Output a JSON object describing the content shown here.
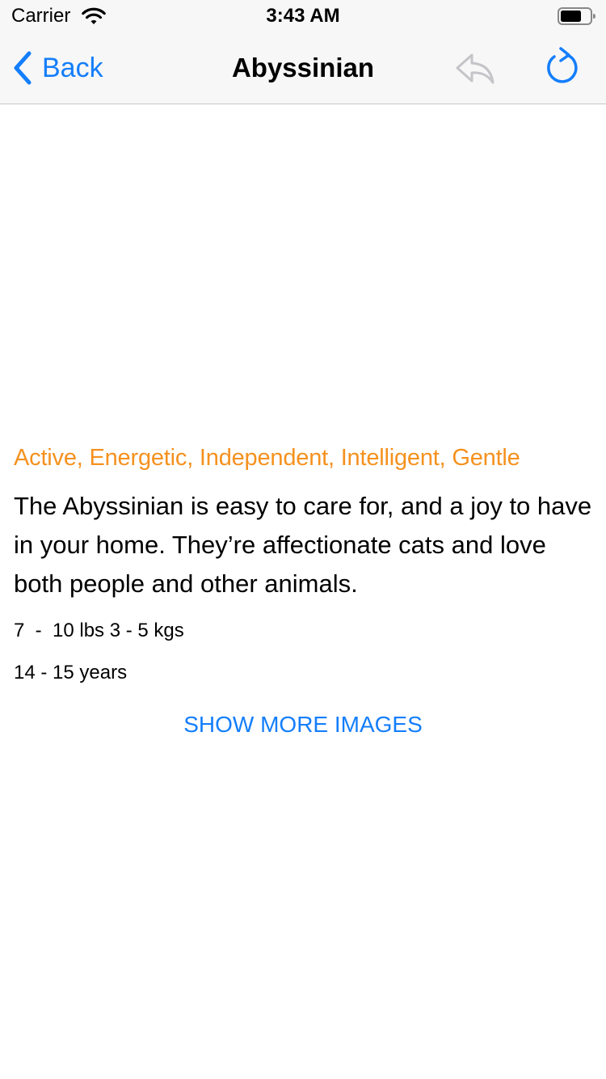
{
  "status_bar": {
    "carrier": "Carrier",
    "time": "3:43 AM",
    "icons": [
      "wifi-icon",
      "battery-icon"
    ]
  },
  "nav": {
    "back_label": "Back",
    "title": "Abyssinian",
    "icons": [
      "chevron-left-icon",
      "reply-icon",
      "refresh-icon"
    ],
    "accent_color": "#147efb",
    "reply_disabled": true
  },
  "breed": {
    "temperament": "Active, Energetic, Independent, Intelligent, Gentle",
    "temperament_color": "#f5911e",
    "description": "The Abyssinian is easy to care for, and a joy to have in your home. They’re affectionate cats and love both people and other animals.",
    "weight": "7  -  10 lbs 3 - 5 kgs",
    "life_span": "14 - 15 years"
  },
  "actions": {
    "show_more_images": "SHOW MORE IMAGES"
  }
}
